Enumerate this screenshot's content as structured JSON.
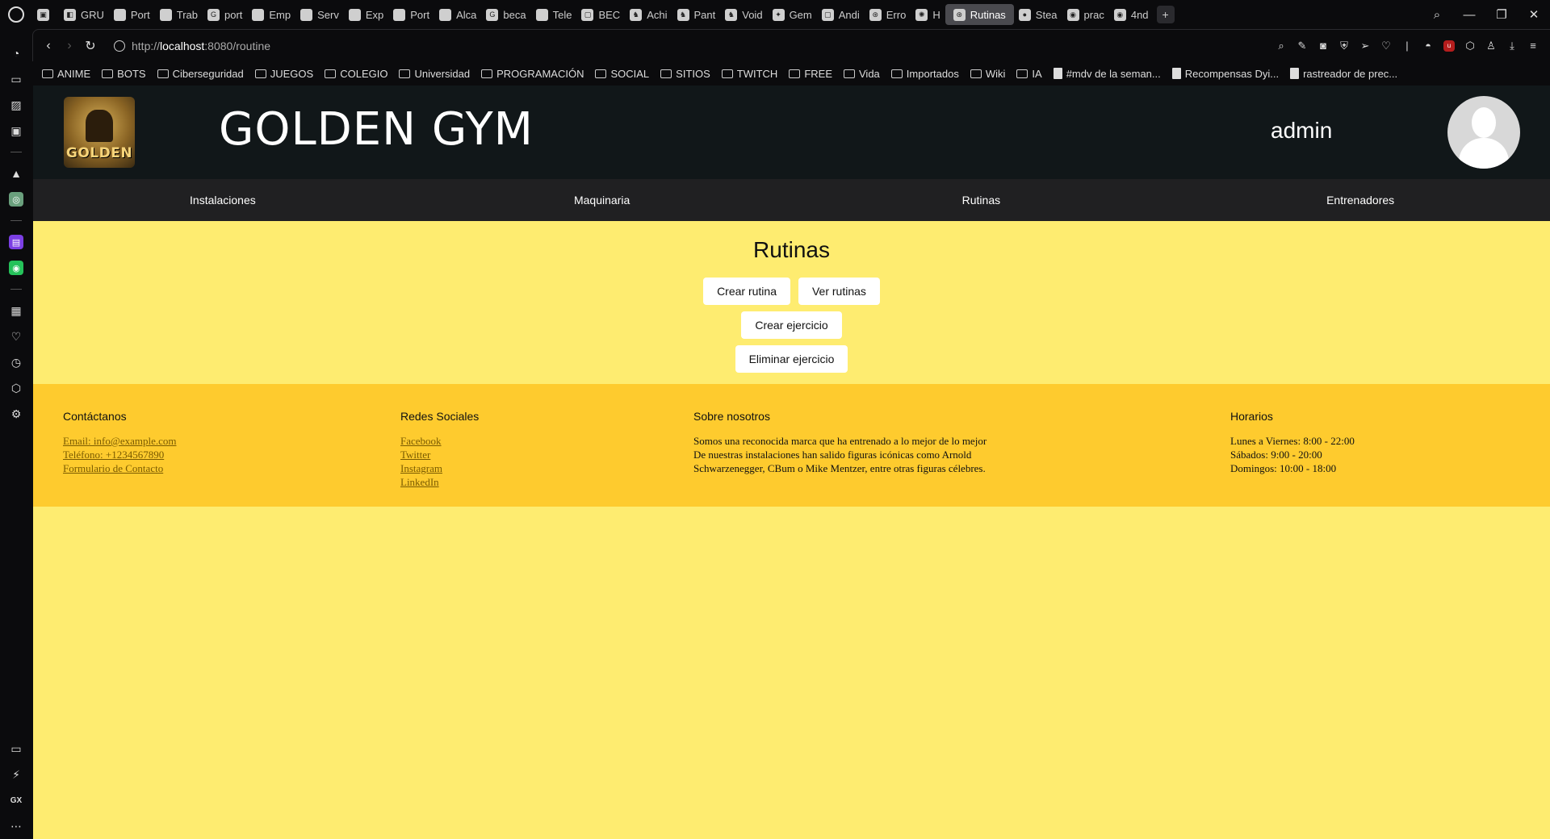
{
  "browser": {
    "tabs": [
      {
        "label": "",
        "icon": "image-icon"
      },
      {
        "label": "GRU",
        "icon": "tab-icon"
      },
      {
        "label": "Port",
        "icon": "doc-icon"
      },
      {
        "label": "Trab",
        "icon": "doc-icon"
      },
      {
        "label": "port",
        "icon": "google-icon"
      },
      {
        "label": "Emp",
        "icon": "doc-icon"
      },
      {
        "label": "Serv",
        "icon": "doc-icon"
      },
      {
        "label": "Exp",
        "icon": "doc-icon"
      },
      {
        "label": "Port",
        "icon": "doc-icon"
      },
      {
        "label": "Alca",
        "icon": "doc-icon"
      },
      {
        "label": "beca",
        "icon": "google-icon"
      },
      {
        "label": "Tele",
        "icon": "doc-icon"
      },
      {
        "label": "BEC",
        "icon": "app-icon"
      },
      {
        "label": "Achi",
        "icon": "helmet-icon"
      },
      {
        "label": "Pant",
        "icon": "helmet-icon"
      },
      {
        "label": "Void",
        "icon": "helmet-icon"
      },
      {
        "label": "Gem",
        "icon": "star-icon"
      },
      {
        "label": "Andi",
        "icon": "app-icon"
      },
      {
        "label": "Erro",
        "icon": "openai-icon"
      },
      {
        "label": "H",
        "icon": "asterisk-icon"
      }
    ],
    "active_tab": "Rutinas",
    "tabs_after": [
      {
        "label": "Stea",
        "icon": "steam-icon"
      },
      {
        "label": "prac",
        "icon": "github-icon"
      },
      {
        "label": "4nd",
        "icon": "github-icon"
      }
    ],
    "url_prefix": "http://",
    "url_host": "localhost",
    "url_path": ":8080/routine",
    "bookmarks": [
      {
        "label": "ANIME",
        "type": "folder"
      },
      {
        "label": "BOTS",
        "type": "folder"
      },
      {
        "label": "Ciberseguridad",
        "type": "folder"
      },
      {
        "label": "JUEGOS",
        "type": "folder"
      },
      {
        "label": "COLEGIO",
        "type": "folder"
      },
      {
        "label": "Universidad",
        "type": "folder"
      },
      {
        "label": "PROGRAMACIÓN",
        "type": "folder"
      },
      {
        "label": "SOCIAL",
        "type": "folder"
      },
      {
        "label": "SITIOS",
        "type": "folder"
      },
      {
        "label": "TWITCH",
        "type": "folder"
      },
      {
        "label": "FREE",
        "type": "folder"
      },
      {
        "label": "Vida",
        "type": "folder"
      },
      {
        "label": "Importados",
        "type": "folder"
      },
      {
        "label": "Wiki",
        "type": "folder"
      },
      {
        "label": "IA",
        "type": "folder"
      },
      {
        "label": "#mdv de la seman...",
        "type": "doc"
      },
      {
        "label": "Recompensas Dyi...",
        "type": "doc"
      },
      {
        "label": "rastreador de prec...",
        "type": "doc"
      }
    ],
    "sidebar_bottom_label": "GX"
  },
  "site": {
    "title": "GOLDEN GYM",
    "logo_text": "GOLDEN",
    "user": "admin",
    "nav": [
      "Instalaciones",
      "Maquinaria",
      "Rutinas",
      "Entrenadores"
    ]
  },
  "page": {
    "heading": "Rutinas",
    "buttons": {
      "create_routine": "Crear rutina",
      "view_routines": "Ver rutinas",
      "create_exercise": "Crear ejercicio",
      "delete_exercise": "Eliminar ejercicio"
    }
  },
  "footer": {
    "contact": {
      "title": "Contáctanos",
      "email": "Email: info@example.com",
      "phone": "Teléfono: +1234567890",
      "form": "Formulario de Contacto"
    },
    "social": {
      "title": "Redes Sociales",
      "links": [
        "Facebook",
        "Twitter",
        "Instagram",
        "LinkedIn"
      ]
    },
    "about": {
      "title": "Sobre nosotros",
      "lines": [
        "Somos una reconocida marca que ha entrenado a lo mejor de lo mejor",
        "De nuestras instalaciones han salido figuras icónicas como Arnold",
        "Schwarzenegger, CBum o Mike Mentzer, entre otras figuras célebres."
      ]
    },
    "hours": {
      "title": "Horarios",
      "lines": [
        "Lunes a Viernes: 8:00 - 22:00",
        "Sábados: 9:00 - 20:00",
        "Domingos: 10:00 - 18:00"
      ]
    }
  },
  "colors": {
    "page_bg": "#feec70",
    "footer_bg": "#fecb2e",
    "header_bg": "#111719",
    "nav_bg": "#202022"
  }
}
